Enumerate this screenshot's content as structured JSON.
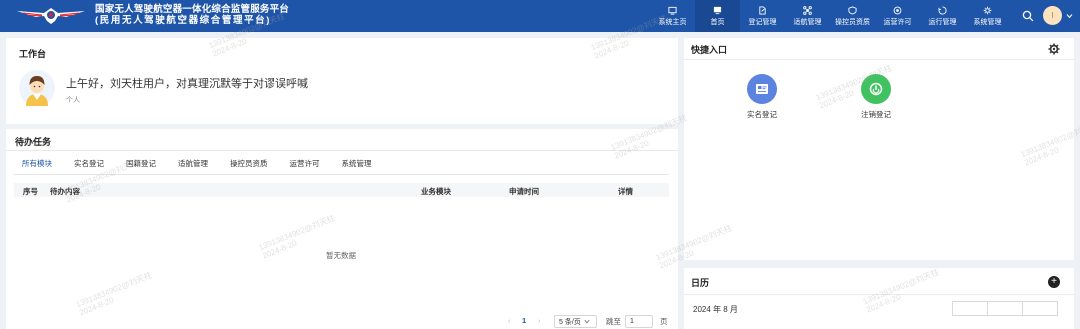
{
  "header": {
    "title_line1": "国家无人驾驶航空器一体化综合监管服务平台",
    "title_line2": "(民用无人驾驶航空器综合管理平台)",
    "nav": [
      {
        "label": "系统主页",
        "icon": "home-screen-icon"
      },
      {
        "label": "首页",
        "icon": "monitor-icon",
        "active": true
      },
      {
        "label": "登记管理",
        "icon": "document-edit-icon"
      },
      {
        "label": "适航管理",
        "icon": "drone-icon"
      },
      {
        "label": "操控员资质",
        "icon": "id-badge-icon"
      },
      {
        "label": "运营许可",
        "icon": "license-icon"
      },
      {
        "label": "运行管理",
        "icon": "operation-icon"
      },
      {
        "label": "系统管理",
        "icon": "system-icon"
      }
    ],
    "avatar_initial": "I"
  },
  "workbench": {
    "title": "工作台",
    "greeting": "上午好，刘天柱用户，对真理沉默等于对谬误呼喊",
    "role": "个人"
  },
  "tasks": {
    "title": "待办任务",
    "tabs": [
      "所有模块",
      "实名登记",
      "国籍登记",
      "适航管理",
      "操控员资质",
      "运营许可",
      "系统管理"
    ],
    "columns": [
      "序号",
      "待办内容",
      "业务模块",
      "申请时间",
      "详情"
    ],
    "empty_text": "暂无数据",
    "pagination": {
      "prev": "‹",
      "page": "1",
      "next": "›",
      "page_size": "5 条/页",
      "goto_label": "跳至",
      "goto_value": "1",
      "page_unit": "页"
    }
  },
  "quick_entry": {
    "title": "快捷入口",
    "items": [
      {
        "label": "实名登记",
        "icon": "id-card-icon",
        "color": "#5b84e0"
      },
      {
        "label": "注销登记",
        "icon": "power-icon",
        "color": "#3fc25f"
      }
    ]
  },
  "calendar": {
    "title": "日历",
    "month": "2024 年 8 月"
  },
  "watermark": {
    "line1": "13913834902@刘天柱",
    "line2": "2024-8-20"
  },
  "colors": {
    "primary": "#1f55a8",
    "nav_active": "#1a4993"
  }
}
